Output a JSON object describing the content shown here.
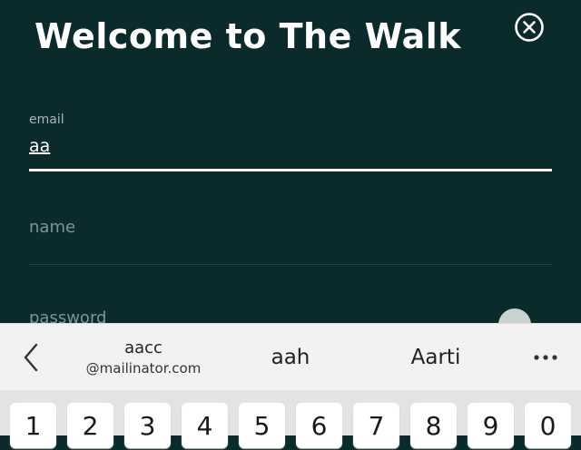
{
  "header": {
    "title": "Welcome to The Walk",
    "close_icon": "close-circle-icon"
  },
  "form": {
    "email": {
      "label": "email",
      "value": "aa"
    },
    "name": {
      "placeholder": "name"
    },
    "password": {
      "placeholder": "password",
      "toggle_icon": "eye-icon"
    }
  },
  "keyboard": {
    "suggestions": [
      "aacc",
      "@mailinator.com",
      "aah",
      "Aarti"
    ],
    "more_icon": "more-dots-icon",
    "back_icon": "chevron-left-icon",
    "number_row": [
      "1",
      "2",
      "3",
      "4",
      "5",
      "6",
      "7",
      "8",
      "9",
      "0"
    ]
  },
  "colors": {
    "background": "#0b2a2c",
    "text": "#ffffff",
    "keyboard_bg": "#e3e3e3"
  }
}
